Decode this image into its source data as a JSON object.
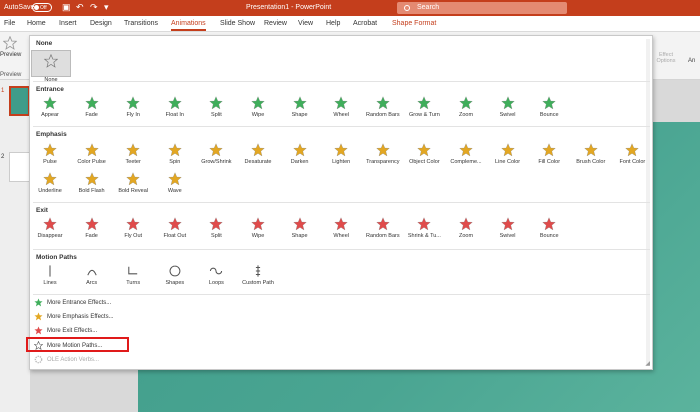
{
  "titlebar": {
    "autosave": "AutoSave",
    "toggle": "Off",
    "undo": "↶",
    "redo": "↷",
    "save": "▣",
    "customize": "▾",
    "title": "Presentation1 - PowerPoint",
    "search": "Search"
  },
  "tabs": [
    "File",
    "Home",
    "Insert",
    "Design",
    "Transitions",
    "Animations",
    "Slide Show",
    "Review",
    "View",
    "Help",
    "Acrobat",
    "Shape Format"
  ],
  "ribbon": {
    "preview_label": "Preview",
    "preview_group": "Preview",
    "effect_options": "Effect Options",
    "an": "An"
  },
  "slides": {
    "n1": "1",
    "n2": "2"
  },
  "gallery": {
    "none_section": "None",
    "none_label": "None",
    "entrance_section": "Entrance",
    "entrance": [
      "Appear",
      "Fade",
      "Fly In",
      "Float In",
      "Split",
      "Wipe",
      "Shape",
      "Wheel",
      "Random Bars",
      "Grow & Turn",
      "Zoom",
      "Swivel",
      "Bounce"
    ],
    "emphasis_section": "Emphasis",
    "emphasis": [
      "Pulse",
      "Color Pulse",
      "Teeter",
      "Spin",
      "Grow/Shrink",
      "Desaturate",
      "Darken",
      "Lighten",
      "Transparency",
      "Object Color",
      "Compleme...",
      "Line Color",
      "Fill Color",
      "Brush Color",
      "Font Color",
      "Underline",
      "Bold Flash",
      "Bold Reveal",
      "Wave"
    ],
    "exit_section": "Exit",
    "exit": [
      "Disappear",
      "Fade",
      "Fly Out",
      "Float Out",
      "Split",
      "Wipe",
      "Shape",
      "Wheel",
      "Random Bars",
      "Shrink & Tu...",
      "Zoom",
      "Swivel",
      "Bounce"
    ],
    "motion_section": "Motion Paths",
    "motion": [
      "Lines",
      "Arcs",
      "Turns",
      "Shapes",
      "Loops",
      "Custom Path"
    ],
    "more_entrance": "More Entrance Effects...",
    "more_emphasis": "More Emphasis Effects...",
    "more_exit": "More Exit Effects...",
    "more_motion": "More Motion Paths...",
    "ole": "OLE Action Verbs..."
  },
  "colors": {
    "brand": "#c43e1c",
    "entrance": "#3fae5b",
    "emphasis": "#e3a722",
    "exit": "#e04b4b",
    "motion": "#555555",
    "highlight": "#e01a1a"
  }
}
